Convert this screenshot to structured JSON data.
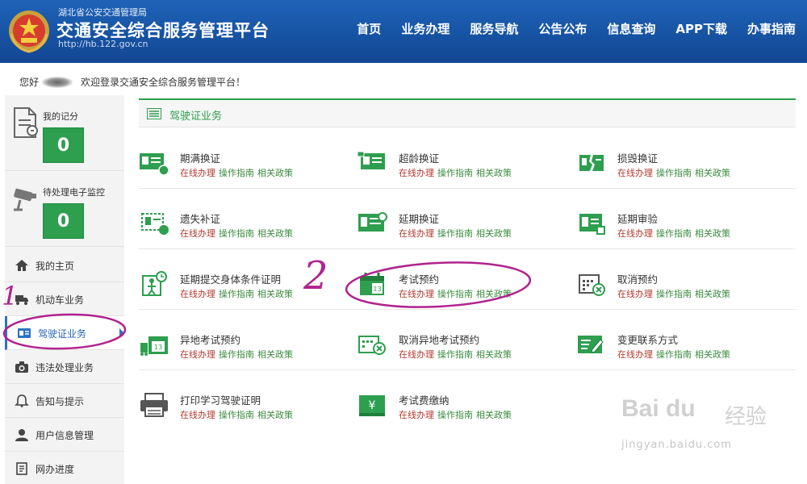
{
  "header": {
    "org": "湖北省公安交通管理局",
    "site_name": "交通安全综合服务管理平台",
    "url": "http://hb.122.gov.cn",
    "nav": [
      "首页",
      "业务办理",
      "服务导航",
      "公告公布",
      "信息查询",
      "APP下载",
      "办事指南"
    ]
  },
  "greeting": {
    "prefix": "您好",
    "welcome": "欢迎登录交通安全综合服务管理平台！"
  },
  "sidebar": {
    "panels": [
      {
        "label": "我的记分",
        "count": "0",
        "icon": "score-document-icon"
      },
      {
        "label": "待处理电子监控",
        "count": "0",
        "icon": "camera-monitor-icon"
      }
    ],
    "items": [
      {
        "label": "我的主页",
        "icon": "home-icon"
      },
      {
        "label": "机动车业务",
        "icon": "truck-icon"
      },
      {
        "label": "驾驶证业务",
        "icon": "id-card-icon",
        "active": true
      },
      {
        "label": "违法处理业务",
        "icon": "camera-icon"
      },
      {
        "label": "告知与提示",
        "icon": "bell-icon"
      },
      {
        "label": "用户信息管理",
        "icon": "user-icon"
      },
      {
        "label": "网办进度",
        "icon": "progress-icon"
      }
    ]
  },
  "section": {
    "title": "驾驶证业务",
    "link_labels": {
      "online": "在线办理",
      "guide": "操作指南",
      "policy": "相关政策"
    },
    "services": [
      {
        "name": "期满换证",
        "icon": "license-renew-icon"
      },
      {
        "name": "超龄换证",
        "icon": "license-age-icon"
      },
      {
        "name": "损毁换证",
        "icon": "license-damaged-icon"
      },
      {
        "name": "遗失补证",
        "icon": "license-lost-icon"
      },
      {
        "name": "延期换证",
        "icon": "license-delay-icon"
      },
      {
        "name": "延期审验",
        "icon": "license-review-icon"
      },
      {
        "name": "延期提交身体条件证明",
        "icon": "health-proof-icon"
      },
      {
        "name": "考试预约",
        "icon": "exam-calendar-icon"
      },
      {
        "name": "取消预约",
        "icon": "cancel-calendar-icon"
      },
      {
        "name": "异地考试预约",
        "icon": "remote-exam-icon"
      },
      {
        "name": "取消异地考试预约",
        "icon": "cancel-remote-icon"
      },
      {
        "name": "变更联系方式",
        "icon": "edit-contact-icon"
      },
      {
        "name": "打印学习驾驶证明",
        "icon": "printer-icon"
      },
      {
        "name": "考试费缴纳",
        "icon": "payment-icon"
      }
    ]
  },
  "annotations": {
    "mark_one": "1",
    "mark_two": "2"
  },
  "watermark": {
    "brand": "Bai du",
    "name": "经验",
    "url": "jingyan.baidu.com"
  },
  "colors": {
    "header_blue": "#1753a3",
    "green": "#2e9e4f",
    "link_red": "#b23a2e",
    "link_green": "#3a8a3e",
    "annotation": "#b0238e"
  }
}
